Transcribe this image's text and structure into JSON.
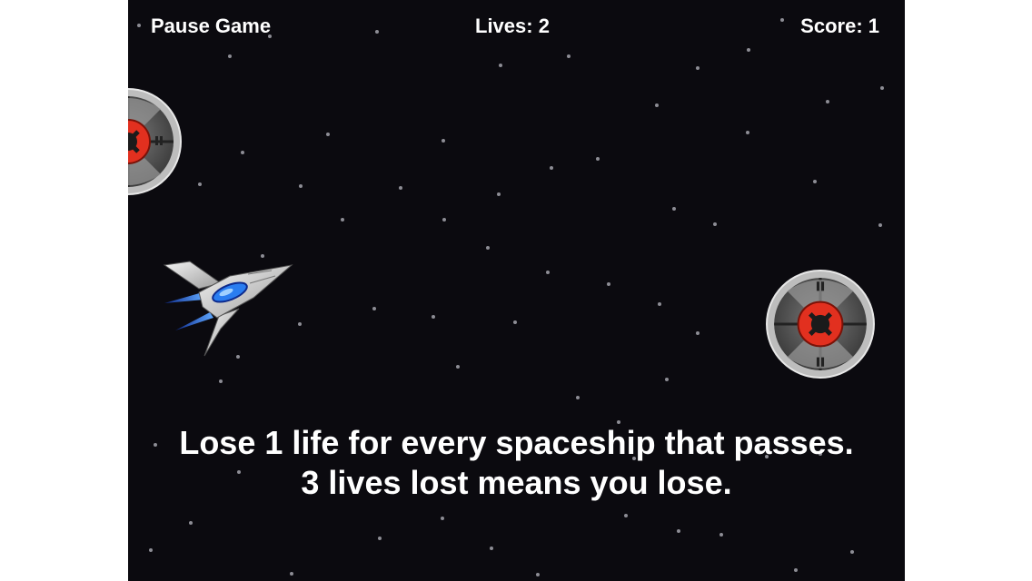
{
  "hud": {
    "pause_label": "Pause Game",
    "lives_text": "Lives: 2",
    "score_text": "Score: 1"
  },
  "message": {
    "line1": "Lose 1 life for every spaceship that passes.",
    "line2": "3 lives lost means you lose."
  },
  "colors": {
    "background": "#0b0a0f",
    "text": "#ffffff",
    "ufo_core": "#e2301f",
    "ship_accent": "#2a7df0"
  }
}
